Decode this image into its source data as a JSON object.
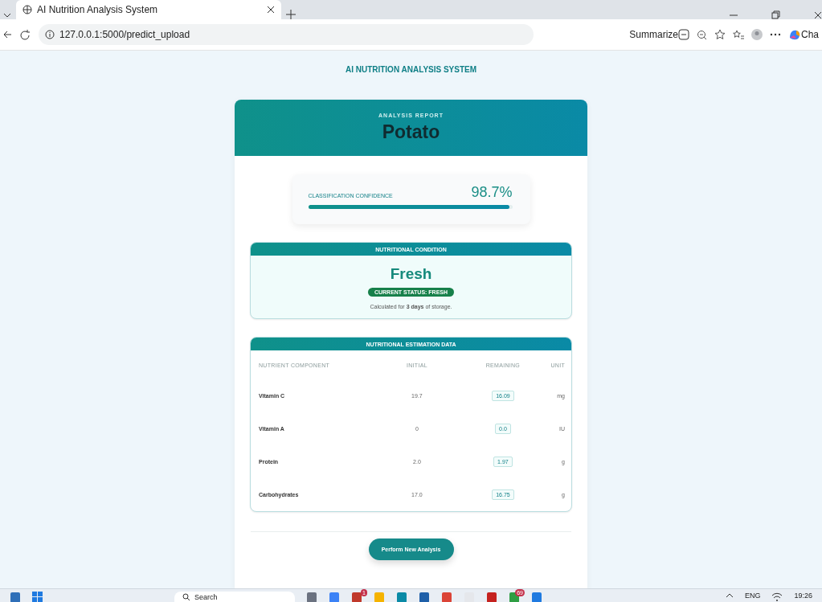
{
  "browser": {
    "tab_title": "AI Nutrition Analysis System",
    "url": "127.0.0.1:5000/predict_upload",
    "summarize": "Summarize",
    "copilot": "Cha"
  },
  "page": {
    "app_title": "AI NUTRITION ANALYSIS SYSTEM"
  },
  "report": {
    "eyebrow": "ANALYSIS REPORT",
    "item": "Potato",
    "confidence": {
      "label": "CLASSIFICATION CONFIDENCE",
      "value": "98.7%",
      "level": 0.987
    },
    "condition": {
      "heading": "NUTRITIONAL CONDITION",
      "status": "Fresh",
      "badge": "CURRENT STATUS: FRESH",
      "note": "Calculated for **3 days** of storage."
    },
    "estimation": {
      "heading": "NUTRITIONAL ESTIMATION DATA",
      "columns": [
        "NUTRIENT COMPONENT",
        "INITIAL",
        "REMAINING",
        "UNIT"
      ],
      "rows": [
        {
          "nutrient": "Vitamin C",
          "initial": "19.7",
          "remaining": "16.09",
          "unit": "mg"
        },
        {
          "nutrient": "Vitamin A",
          "initial": "0",
          "remaining": "0.0",
          "unit": "IU"
        },
        {
          "nutrient": "Protein",
          "initial": "2.0",
          "remaining": "1.97",
          "unit": "g"
        },
        {
          "nutrient": "Carbohydrates",
          "initial": "17.0",
          "remaining": "16.75",
          "unit": "g"
        }
      ]
    },
    "action": "Perform New Analysis"
  },
  "taskbar": {
    "search": "Search",
    "badges": [
      "1",
      "69"
    ],
    "language": "ENG",
    "time": "19:26"
  }
}
